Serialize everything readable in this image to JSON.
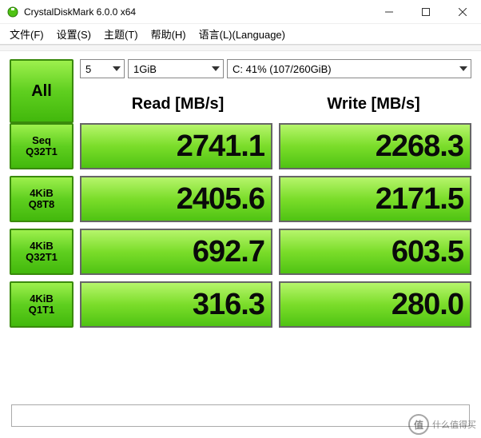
{
  "window": {
    "title": "CrystalDiskMark 6.0.0 x64"
  },
  "menu": {
    "file": "文件(F)",
    "settings": "设置(S)",
    "theme": "主题(T)",
    "help": "帮助(H)",
    "language": "语言(L)(Language)"
  },
  "controls": {
    "all_label": "All",
    "count_value": "5",
    "size_value": "1GiB",
    "drive_value": "C: 41% (107/260GiB)"
  },
  "columns": {
    "read": "Read [MB/s]",
    "write": "Write [MB/s]"
  },
  "tests": [
    {
      "label1": "Seq",
      "label2": "Q32T1",
      "read": "2741.1",
      "write": "2268.3"
    },
    {
      "label1": "4KiB",
      "label2": "Q8T8",
      "read": "2405.6",
      "write": "2171.5"
    },
    {
      "label1": "4KiB",
      "label2": "Q32T1",
      "read": "692.7",
      "write": "603.5"
    },
    {
      "label1": "4KiB",
      "label2": "Q1T1",
      "read": "316.3",
      "write": "280.0"
    }
  ],
  "watermark": {
    "badge": "值",
    "text": "什么值得买"
  }
}
